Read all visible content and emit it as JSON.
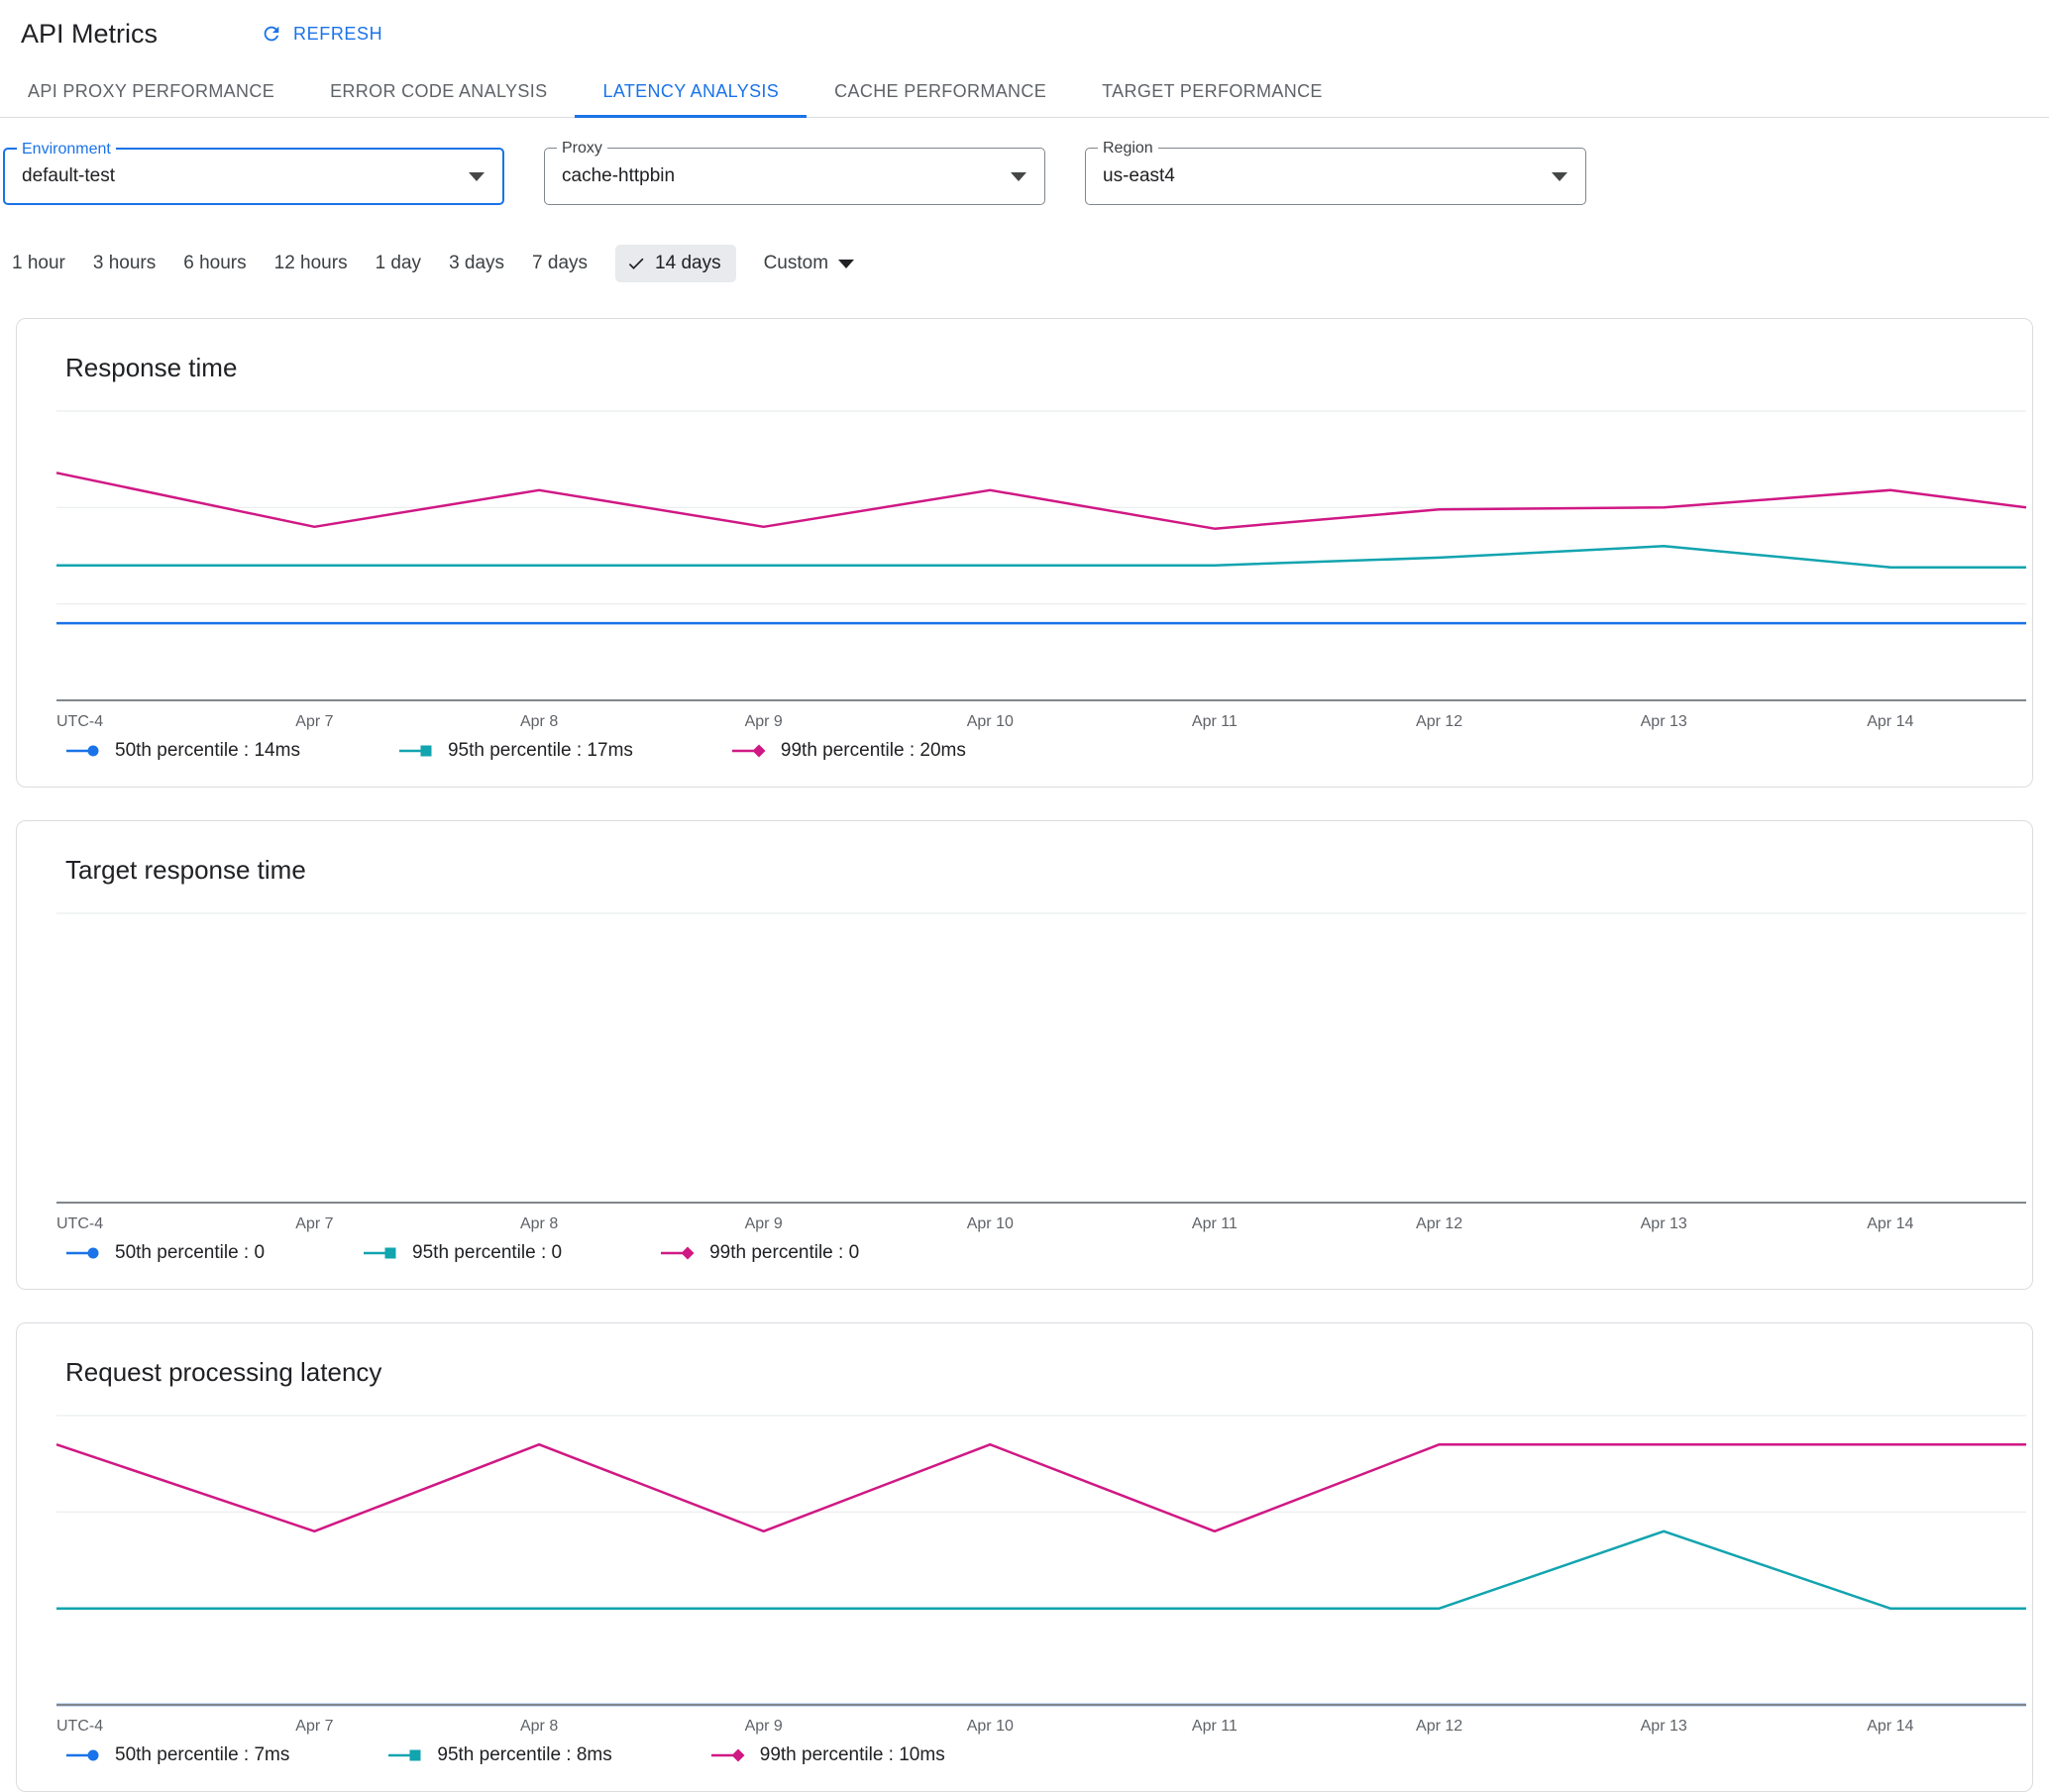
{
  "header": {
    "title": "API Metrics",
    "refresh_label": "REFRESH"
  },
  "tabs": [
    {
      "label": "API PROXY PERFORMANCE",
      "active": false
    },
    {
      "label": "ERROR CODE ANALYSIS",
      "active": false
    },
    {
      "label": "LATENCY ANALYSIS",
      "active": true
    },
    {
      "label": "CACHE PERFORMANCE",
      "active": false
    },
    {
      "label": "TARGET PERFORMANCE",
      "active": false
    }
  ],
  "filters": [
    {
      "label": "Environment",
      "value": "default-test",
      "focused": true
    },
    {
      "label": "Proxy",
      "value": "cache-httpbin",
      "focused": false
    },
    {
      "label": "Region",
      "value": "us-east4",
      "focused": false
    }
  ],
  "time_ranges": {
    "options": [
      "1 hour",
      "3 hours",
      "6 hours",
      "12 hours",
      "1 day",
      "3 days",
      "7 days",
      "14 days"
    ],
    "selected": "14 days",
    "custom_label": "Custom"
  },
  "colors": {
    "accent": "#1a73e8",
    "p50": "#1a73e8",
    "p95": "#12a4af",
    "p99": "#d01884",
    "grid": "#e6e8ea",
    "axis": "#80868b",
    "selected_pill_bg": "#e8eaed"
  },
  "chart_data": [
    {
      "type": "line",
      "title": "Response time",
      "x_axis_label": "UTC-4",
      "x_ticks": [
        "Apr 7",
        "Apr 8",
        "Apr 9",
        "Apr 10",
        "Apr 11",
        "Apr 12",
        "Apr 13",
        "Apr 14"
      ],
      "x_tick_fractions": [
        0.131,
        0.245,
        0.359,
        0.474,
        0.588,
        0.702,
        0.816,
        0.931
      ],
      "x_fractions": [
        0,
        0.131,
        0.245,
        0.359,
        0.474,
        0.588,
        0.702,
        0.816,
        0.931,
        1
      ],
      "ylim": [
        10,
        25
      ],
      "gridline_values": [
        10,
        15,
        20,
        25
      ],
      "grid": true,
      "legend_position": "bottom",
      "series": [
        {
          "name": "50th percentile",
          "legend_label": "50th percentile : 14ms",
          "color": "#1a73e8",
          "marker": "circle",
          "values": [
            14,
            14,
            14,
            14,
            14,
            14,
            14,
            14,
            14,
            14
          ]
        },
        {
          "name": "95th percentile",
          "legend_label": "95th percentile : 17ms",
          "color": "#12a4af",
          "marker": "square",
          "values": [
            17,
            17,
            17,
            17,
            17,
            17,
            17.4,
            18,
            16.9,
            16.9
          ]
        },
        {
          "name": "99th percentile",
          "legend_label": "99th percentile : 20ms",
          "color": "#d01884",
          "marker": "diamond",
          "values": [
            21.8,
            19,
            20.9,
            19,
            20.9,
            18.9,
            19.9,
            20,
            20.9,
            20
          ]
        }
      ]
    },
    {
      "type": "line",
      "title": "Target response time",
      "x_axis_label": "UTC-4",
      "x_ticks": [
        "Apr 7",
        "Apr 8",
        "Apr 9",
        "Apr 10",
        "Apr 11",
        "Apr 12",
        "Apr 13",
        "Apr 14"
      ],
      "x_tick_fractions": [
        0.131,
        0.245,
        0.359,
        0.474,
        0.588,
        0.702,
        0.816,
        0.931
      ],
      "x_fractions": [
        0,
        0.131,
        0.245,
        0.359,
        0.474,
        0.588,
        0.702,
        0.816,
        0.931,
        1
      ],
      "ylim": [
        0,
        1
      ],
      "gridline_values": [
        0,
        1
      ],
      "grid": true,
      "legend_position": "bottom",
      "note": "no data plotted - all values are 0",
      "series": [
        {
          "name": "50th percentile",
          "legend_label": "50th percentile : 0",
          "color": "#1a73e8",
          "marker": "circle",
          "values": []
        },
        {
          "name": "95th percentile",
          "legend_label": "95th percentile : 0",
          "color": "#12a4af",
          "marker": "square",
          "values": []
        },
        {
          "name": "99th percentile",
          "legend_label": "99th percentile : 0",
          "color": "#d01884",
          "marker": "diamond",
          "values": []
        }
      ]
    },
    {
      "type": "line",
      "title": "Request processing latency",
      "x_axis_label": "UTC-4",
      "x_ticks": [
        "Apr 7",
        "Apr 8",
        "Apr 9",
        "Apr 10",
        "Apr 11",
        "Apr 12",
        "Apr 13",
        "Apr 14"
      ],
      "x_tick_fractions": [
        0.131,
        0.245,
        0.359,
        0.474,
        0.588,
        0.702,
        0.816,
        0.931
      ],
      "x_fractions": [
        0,
        0.131,
        0.245,
        0.359,
        0.474,
        0.588,
        0.702,
        0.816,
        0.931,
        1
      ],
      "ylim": [
        7,
        10
      ],
      "gridline_values": [
        7,
        8,
        9,
        10
      ],
      "grid": true,
      "legend_position": "bottom",
      "series": [
        {
          "name": "50th percentile",
          "legend_label": "50th percentile : 7ms",
          "color": "#1a73e8",
          "marker": "circle",
          "values": [
            7,
            7,
            7,
            7,
            7,
            7,
            7,
            7,
            7,
            7
          ]
        },
        {
          "name": "95th percentile",
          "legend_label": "95th percentile : 8ms",
          "color": "#12a4af",
          "marker": "square",
          "values": [
            8,
            8,
            8,
            8,
            8,
            8,
            8,
            8.8,
            8,
            8
          ]
        },
        {
          "name": "99th percentile",
          "legend_label": "99th percentile : 10ms",
          "color": "#d01884",
          "marker": "diamond",
          "values": [
            9.7,
            8.8,
            9.7,
            8.8,
            9.7,
            8.8,
            9.7,
            9.7,
            9.7,
            9.7
          ]
        }
      ]
    }
  ]
}
